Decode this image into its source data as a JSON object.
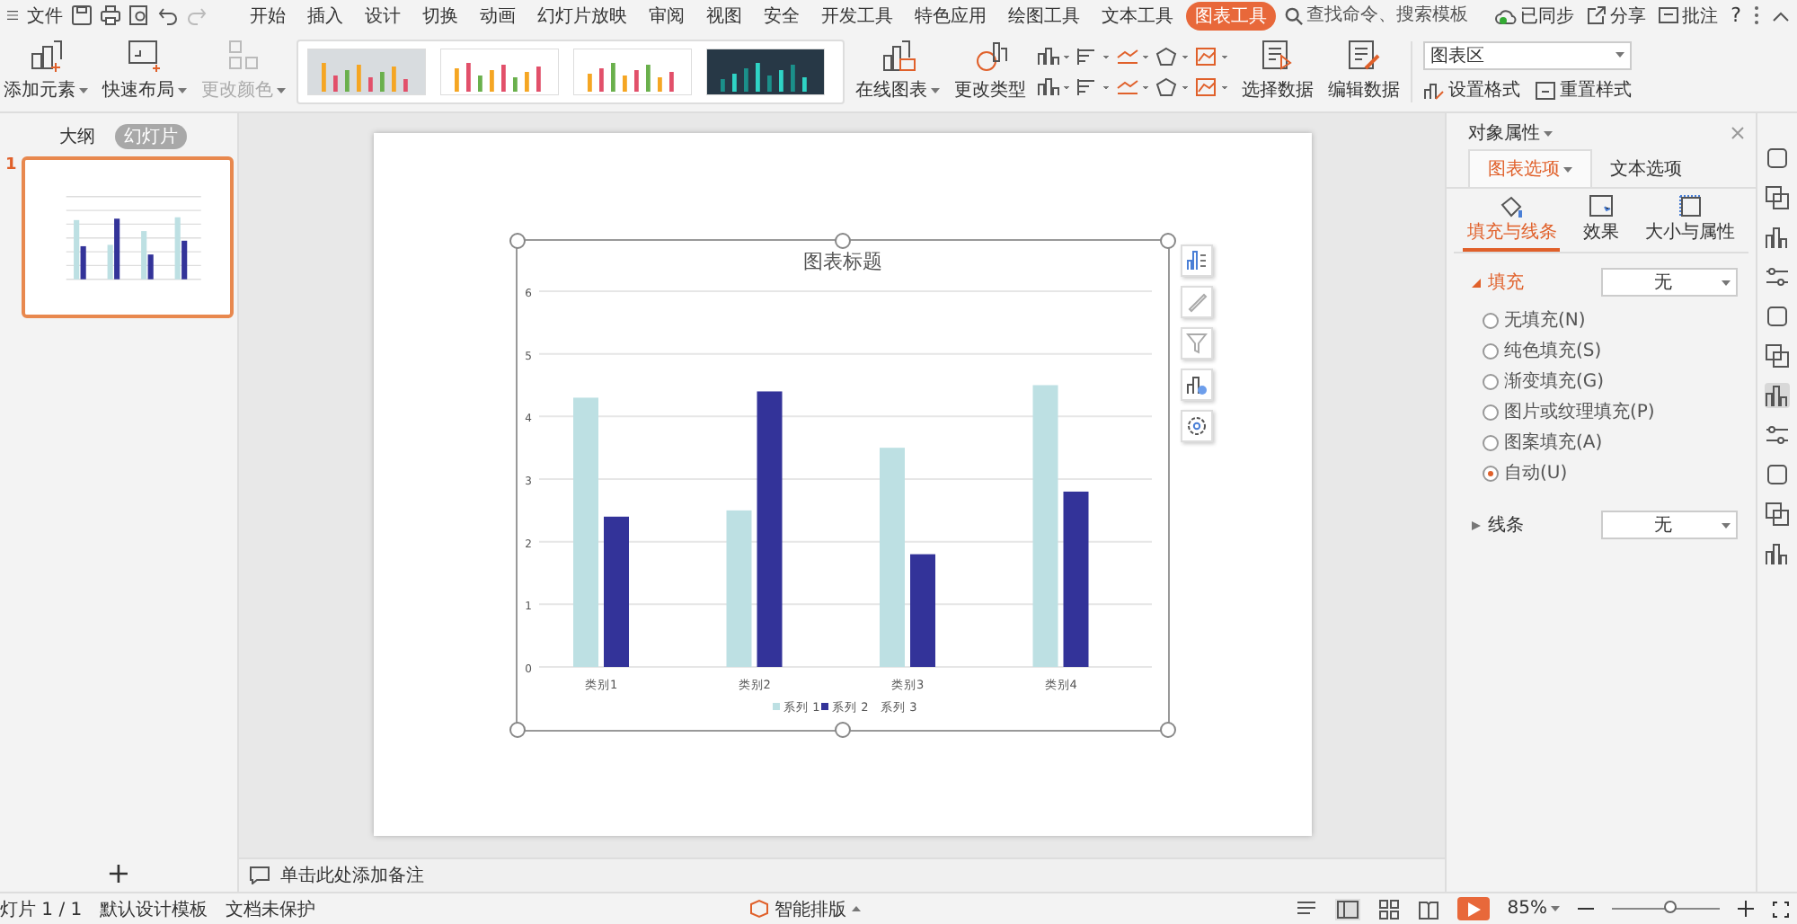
{
  "menu_bar": {
    "file_menu": "文件",
    "tabs": [
      {
        "label": "开始",
        "selected": false
      },
      {
        "label": "插入",
        "selected": false
      },
      {
        "label": "设计",
        "selected": false
      },
      {
        "label": "切换",
        "selected": false
      },
      {
        "label": "动画",
        "selected": false
      },
      {
        "label": "幻灯片放映",
        "selected": false
      },
      {
        "label": "审阅",
        "selected": false
      },
      {
        "label": "视图",
        "selected": false
      },
      {
        "label": "安全",
        "selected": false
      },
      {
        "label": "开发工具",
        "selected": false
      },
      {
        "label": "特色应用",
        "selected": false
      },
      {
        "label": "绘图工具",
        "selected": false
      },
      {
        "label": "文本工具",
        "selected": false
      },
      {
        "label": "图表工具",
        "selected": true
      }
    ],
    "search": {
      "placeholder": "查找命令、搜索模板"
    },
    "sync": "已同步",
    "share": "分享",
    "comment": "批注",
    "help": "?"
  },
  "ribbon": {
    "tools": [
      {
        "label": "添加元素",
        "disabled": false
      },
      {
        "label": "快速布局",
        "disabled": false
      },
      {
        "label": "更改颜色",
        "disabled": true
      }
    ],
    "chart_tools": [
      {
        "label": "在线图表"
      },
      {
        "label": "更改类型"
      }
    ],
    "data_tools": [
      {
        "label": "选择数据"
      },
      {
        "label": "编辑数据"
      }
    ],
    "element_select": {
      "value": "图表区"
    },
    "format_buttons": [
      {
        "label": "设置格式"
      },
      {
        "label": "重置样式"
      }
    ]
  },
  "slides_panel": {
    "tabs": [
      {
        "label": "大纲",
        "selected": false
      },
      {
        "label": "幻灯片",
        "selected": true
      }
    ],
    "slides": [
      {
        "number": "1",
        "selected": true
      }
    ],
    "add_button": "+"
  },
  "slide": {
    "chart": {
      "chart_data": {
        "type": "bar",
        "title": "图表标题",
        "categories": [
          "类别1",
          "类别2",
          "类别3",
          "类别4"
        ],
        "ylim": [
          0,
          6
        ],
        "yticks": [
          0,
          1,
          2,
          3,
          4,
          5,
          6
        ],
        "grid": true,
        "legend": true,
        "series": [
          {
            "name": "系列 1",
            "color": "#bde0e3",
            "values": [
              4.3,
              2.5,
              3.5,
              4.5
            ]
          },
          {
            "name": "系列 2",
            "color": "#333399",
            "values": [
              2.4,
              4.4,
              1.8,
              2.8
            ]
          },
          {
            "name": "系列 3",
            "values": [
              null,
              null,
              null,
              null
            ]
          }
        ]
      }
    }
  },
  "notes": {
    "placeholder": "单击此处添加备注"
  },
  "properties_panel": {
    "title": "对象属性",
    "tabs": [
      {
        "label": "图表选项",
        "selected": true
      },
      {
        "label": "文本选项",
        "selected": false
      }
    ],
    "subtabs": [
      {
        "label": "填充与线条",
        "selected": true
      },
      {
        "label": "效果",
        "selected": false
      },
      {
        "label": "大小与属性",
        "selected": false
      }
    ],
    "fill": {
      "label": "填充",
      "expanded": true,
      "value": "无",
      "options": [
        {
          "label": "无填充(N)",
          "selected": false
        },
        {
          "label": "纯色填充(S)",
          "selected": false
        },
        {
          "label": "渐变填充(G)",
          "selected": false
        },
        {
          "label": "图片或纹理填充(P)",
          "selected": false
        },
        {
          "label": "图案填充(A)",
          "selected": false
        },
        {
          "label": "自动(U)",
          "selected": true
        }
      ]
    },
    "line": {
      "label": "线条",
      "expanded": false,
      "value": "无"
    }
  },
  "status_bar": {
    "slide_count": "灯片 1 / 1",
    "template": "默认设计模板",
    "protection": "文档未保护",
    "smart_layout": "智能排版",
    "zoom": "85%",
    "zoom_slider": {
      "level": 0.55
    }
  }
}
